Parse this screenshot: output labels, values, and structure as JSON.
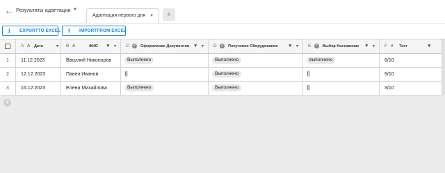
{
  "header": {
    "view_title": "Результаты адаптации",
    "tab_label": "Адаптация первого дня",
    "add_tab": "+"
  },
  "toolbar": {
    "export_label": "EXPORTTO EXCEL",
    "import_label": "IMPORTFROM EXCEL"
  },
  "columns": [
    {
      "letter": "A",
      "label": "Дата"
    },
    {
      "letter": "B",
      "label": "ФИО"
    },
    {
      "letter": "C",
      "label": "Оформление Документов"
    },
    {
      "letter": "D",
      "label": "Получение Оборудования"
    },
    {
      "letter": "E",
      "label": "Выбор Наставника"
    },
    {
      "letter": "F",
      "label": "Тест"
    }
  ],
  "rows": [
    {
      "num": "1",
      "date": "11.12.2023",
      "name": "Василий Никоноров",
      "docs": "Выполнено",
      "equip": "Выполнено",
      "mentor": "выполнено",
      "test": "6/10"
    },
    {
      "num": "2",
      "date": "12.12.2023",
      "name": "Павел Иванов",
      "docs": "[]",
      "equip": "Выполнено",
      "mentor": "[]",
      "test": "9/10"
    },
    {
      "num": "3",
      "date": "16.12.2023",
      "name": "Елена Михайлова",
      "docs": "Выполнено",
      "equip": "Выполнено",
      "mentor": "[]",
      "test": "3/10"
    }
  ],
  "colors": {
    "accent": "#1e88e5",
    "header_bg": "#f5f5f5",
    "page_bg": "#ebebeb"
  }
}
